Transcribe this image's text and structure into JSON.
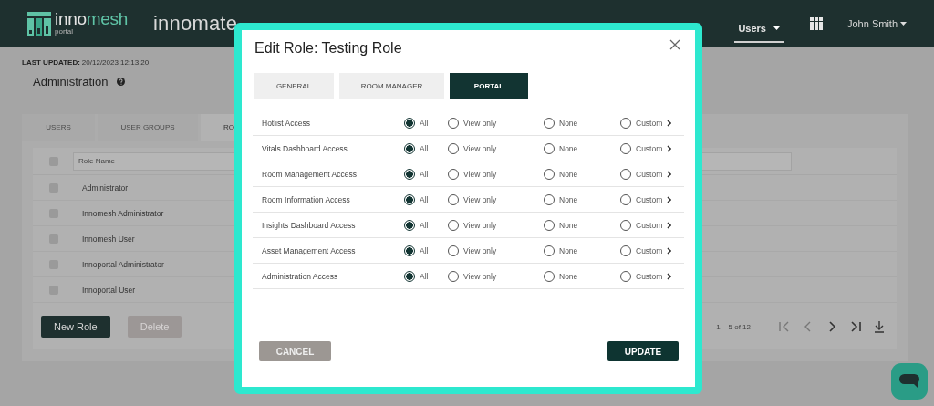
{
  "header": {
    "logo": {
      "prefix": "inno",
      "suffix": "mesh",
      "sub": "portal"
    },
    "product": "innomate",
    "nav": [
      {
        "label": "Users",
        "selected": true
      }
    ],
    "user": "John Smith"
  },
  "page": {
    "last_updated_label": "LAST UPDATED:",
    "last_updated": "20/12/2023 12:13:20",
    "title": "Administration",
    "tabs": [
      {
        "label": "USERS",
        "selected": false
      },
      {
        "label": "USER GROUPS",
        "selected": false
      },
      {
        "label": "RO",
        "selected": true
      }
    ],
    "table": {
      "select_all_checked": false,
      "filter_placeholder": "Role Name",
      "rows": [
        {
          "name": "Administrator",
          "checked": false
        },
        {
          "name": "Innomesh Administrator",
          "checked": false
        },
        {
          "name": "Innomesh User",
          "checked": false
        },
        {
          "name": "Innoportal Administrator",
          "checked": false
        },
        {
          "name": "Innoportal User",
          "checked": false
        }
      ]
    },
    "buttons": [
      {
        "label": "New Role",
        "disabled": false
      },
      {
        "label": "Delete",
        "disabled": true
      }
    ],
    "pagination": "1 – 5 of 12"
  },
  "dialog": {
    "title": "Edit Role: Testing Role",
    "tabs": [
      {
        "label": "GENERAL",
        "selected": false
      },
      {
        "label": "ROOM MANAGER",
        "selected": false
      },
      {
        "label": "PORTAL",
        "selected": true
      }
    ],
    "permissions": [
      {
        "label": "Hotlist Access",
        "options": [
          {
            "label": "All",
            "selected": true,
            "kind": "plain"
          },
          {
            "label": "View only",
            "selected": false,
            "kind": "plain"
          },
          {
            "label": "None",
            "selected": false,
            "kind": "plain"
          },
          {
            "label": "Custom",
            "selected": false,
            "kind": "expand"
          }
        ]
      },
      {
        "label": "Vitals Dashboard Access",
        "options": [
          {
            "label": "All",
            "selected": true,
            "kind": "plain"
          },
          {
            "label": "View only",
            "selected": false,
            "kind": "plain"
          },
          {
            "label": "None",
            "selected": false,
            "kind": "plain"
          },
          {
            "label": "Custom",
            "selected": false,
            "kind": "expand"
          }
        ]
      },
      {
        "label": "Room Management Access",
        "options": [
          {
            "label": "All",
            "selected": true,
            "kind": "plain"
          },
          {
            "label": "View only",
            "selected": false,
            "kind": "plain"
          },
          {
            "label": "None",
            "selected": false,
            "kind": "plain"
          },
          {
            "label": "Custom",
            "selected": false,
            "kind": "expand"
          }
        ]
      },
      {
        "label": "Room Information Access",
        "options": [
          {
            "label": "All",
            "selected": true,
            "kind": "plain"
          },
          {
            "label": "View only",
            "selected": false,
            "kind": "plain"
          },
          {
            "label": "None",
            "selected": false,
            "kind": "plain"
          },
          {
            "label": "Custom",
            "selected": false,
            "kind": "expand"
          }
        ]
      },
      {
        "label": "Insights Dashboard Access",
        "options": [
          {
            "label": "All",
            "selected": true,
            "kind": "plain"
          },
          {
            "label": "View only",
            "selected": false,
            "kind": "plain"
          },
          {
            "label": "None",
            "selected": false,
            "kind": "plain"
          },
          {
            "label": "Custom",
            "selected": false,
            "kind": "expand"
          }
        ]
      },
      {
        "label": "Asset Management Access",
        "options": [
          {
            "label": "All",
            "selected": true,
            "kind": "plain"
          },
          {
            "label": "View only",
            "selected": false,
            "kind": "plain"
          },
          {
            "label": "None",
            "selected": false,
            "kind": "plain"
          },
          {
            "label": "Custom",
            "selected": false,
            "kind": "expand"
          }
        ]
      },
      {
        "label": "Administration Access",
        "options": [
          {
            "label": "All",
            "selected": true,
            "kind": "plain"
          },
          {
            "label": "View only",
            "selected": false,
            "kind": "plain"
          },
          {
            "label": "None",
            "selected": false,
            "kind": "plain"
          },
          {
            "label": "Custom",
            "selected": false,
            "kind": "expand"
          }
        ]
      }
    ],
    "cancel": "CANCEL",
    "update": "UPDATE"
  }
}
